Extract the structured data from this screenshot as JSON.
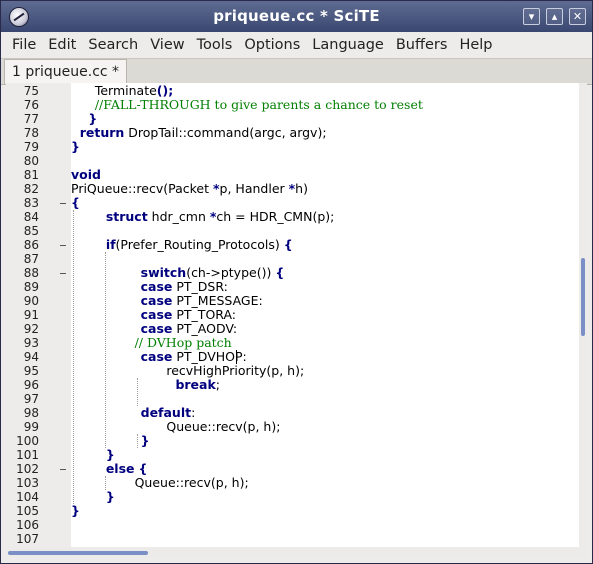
{
  "window": {
    "title": "priqueue.cc * SciTE",
    "controls": {
      "minimize": "▾",
      "maximize": "▴",
      "close": "✕"
    }
  },
  "menu": [
    "File",
    "Edit",
    "Search",
    "View",
    "Tools",
    "Options",
    "Language",
    "Buffers",
    "Help"
  ],
  "tabs": [
    {
      "label": "1 priqueue.cc *",
      "active": true
    }
  ],
  "editor": {
    "lines": [
      {
        "num": "75",
        "indent": 1,
        "fold": false,
        "tokens": [
          {
            "t": "      Terminate",
            "c": ""
          },
          {
            "t": "();",
            "c": "kw"
          }
        ]
      },
      {
        "num": "76",
        "indent": 1,
        "fold": false,
        "tokens": [
          {
            "t": "      //FALL-THROUGH to give parents a chance to reset",
            "c": "cm"
          }
        ]
      },
      {
        "num": "77",
        "indent": 1,
        "fold": false,
        "tokens": [
          {
            "t": "    }",
            "c": "kw"
          }
        ]
      },
      {
        "num": "78",
        "indent": 0,
        "fold": false,
        "tokens": [
          {
            "t": "  return",
            "c": "kw"
          },
          {
            "t": " DropTail::command(argc, argv);",
            "c": ""
          }
        ]
      },
      {
        "num": "79",
        "indent": 0,
        "fold": false,
        "tokens": [
          {
            "t": "}",
            "c": "kw"
          }
        ]
      },
      {
        "num": "80",
        "indent": 0,
        "fold": false,
        "tokens": [
          {
            "t": "",
            "c": ""
          }
        ]
      },
      {
        "num": "81",
        "indent": 0,
        "fold": false,
        "tokens": [
          {
            "t": "void",
            "c": "kw"
          }
        ]
      },
      {
        "num": "82",
        "indent": 0,
        "fold": false,
        "tokens": [
          {
            "t": "PriQueue::recv(Packet ",
            "c": ""
          },
          {
            "t": "*",
            "c": "kw"
          },
          {
            "t": "p, Handler ",
            "c": ""
          },
          {
            "t": "*",
            "c": "kw"
          },
          {
            "t": "h)",
            "c": ""
          }
        ]
      },
      {
        "num": "83",
        "indent": 0,
        "fold": true,
        "tokens": [
          {
            "t": "{",
            "c": "kw"
          }
        ]
      },
      {
        "num": "84",
        "indent": 0,
        "fold": false,
        "tokens": [
          {
            "t": "        struct",
            "c": "kw"
          },
          {
            "t": " hdr_cmn ",
            "c": ""
          },
          {
            "t": "*",
            "c": "kw"
          },
          {
            "t": "ch = HDR_CMN(p);",
            "c": ""
          }
        ]
      },
      {
        "num": "85",
        "indent": 0,
        "fold": false,
        "tokens": [
          {
            "t": "",
            "c": ""
          }
        ]
      },
      {
        "num": "86",
        "indent": 0,
        "fold": true,
        "tokens": [
          {
            "t": "        if",
            "c": "kw"
          },
          {
            "t": "(Prefer_Routing_Protocols) ",
            "c": ""
          },
          {
            "t": "{",
            "c": "kw"
          }
        ]
      },
      {
        "num": "87",
        "indent": 0,
        "fold": false,
        "tokens": [
          {
            "t": "",
            "c": ""
          }
        ]
      },
      {
        "num": "88",
        "indent": 0,
        "fold": true,
        "tokens": [
          {
            "t": "                switch",
            "c": "kw"
          },
          {
            "t": "(ch->ptype()) ",
            "c": ""
          },
          {
            "t": "{",
            "c": "kw"
          }
        ]
      },
      {
        "num": "89",
        "indent": 0,
        "fold": false,
        "tokens": [
          {
            "t": "                case",
            "c": "kw"
          },
          {
            "t": " PT_DSR:",
            "c": ""
          }
        ]
      },
      {
        "num": "90",
        "indent": 0,
        "fold": false,
        "tokens": [
          {
            "t": "                case",
            "c": "kw"
          },
          {
            "t": " PT_MESSAGE:",
            "c": ""
          }
        ]
      },
      {
        "num": "91",
        "indent": 0,
        "fold": false,
        "tokens": [
          {
            "t": "                case",
            "c": "kw"
          },
          {
            "t": " PT_TORA:",
            "c": ""
          }
        ]
      },
      {
        "num": "92",
        "indent": 0,
        "fold": false,
        "tokens": [
          {
            "t": "                case",
            "c": "kw"
          },
          {
            "t": " PT_AODV:",
            "c": ""
          }
        ]
      },
      {
        "num": "93",
        "indent": 0,
        "fold": false,
        "tokens": [
          {
            "t": "                // DVHop patch",
            "c": "cm"
          }
        ]
      },
      {
        "num": "94",
        "indent": 0,
        "fold": false,
        "tokens": [
          {
            "t": "                case",
            "c": "kw"
          },
          {
            "t": " PT_DVHOP:",
            "c": ""
          }
        ]
      },
      {
        "num": "95",
        "indent": 0,
        "fold": false,
        "tokens": [
          {
            "t": "                        recvHighPriority(p, h);",
            "c": ""
          }
        ]
      },
      {
        "num": "96",
        "indent": 0,
        "fold": false,
        "tokens": [
          {
            "t": "                        break",
            "c": "kw"
          },
          {
            "t": ";",
            "c": ""
          }
        ]
      },
      {
        "num": "97",
        "indent": 0,
        "fold": false,
        "tokens": [
          {
            "t": "",
            "c": ""
          }
        ]
      },
      {
        "num": "98",
        "indent": 0,
        "fold": false,
        "tokens": [
          {
            "t": "                default",
            "c": "kw"
          },
          {
            "t": ":",
            "c": ""
          }
        ]
      },
      {
        "num": "99",
        "indent": 0,
        "fold": false,
        "tokens": [
          {
            "t": "                        Queue::recv(p, h);",
            "c": ""
          }
        ]
      },
      {
        "num": "100",
        "indent": 0,
        "fold": false,
        "tokens": [
          {
            "t": "                }",
            "c": "kw"
          }
        ]
      },
      {
        "num": "101",
        "indent": 0,
        "fold": false,
        "tokens": [
          {
            "t": "        }",
            "c": "kw"
          }
        ]
      },
      {
        "num": "102",
        "indent": 0,
        "fold": true,
        "tokens": [
          {
            "t": "        else",
            "c": "kw"
          },
          {
            "t": " ",
            "c": ""
          },
          {
            "t": "{",
            "c": "kw"
          }
        ]
      },
      {
        "num": "103",
        "indent": 0,
        "fold": false,
        "tokens": [
          {
            "t": "                Queue::recv(p, h);",
            "c": ""
          }
        ]
      },
      {
        "num": "104",
        "indent": 0,
        "fold": false,
        "tokens": [
          {
            "t": "        }",
            "c": "kw"
          }
        ]
      },
      {
        "num": "105",
        "indent": 0,
        "fold": false,
        "tokens": [
          {
            "t": "}",
            "c": "kw"
          }
        ]
      },
      {
        "num": "106",
        "indent": 0,
        "fold": false,
        "tokens": [
          {
            "t": "",
            "c": ""
          }
        ]
      },
      {
        "num": "107",
        "indent": 0,
        "fold": false,
        "tokens": [
          {
            "t": "",
            "c": ""
          }
        ]
      }
    ]
  },
  "colors": {
    "keyword": "#00007f",
    "comment": "#007f00",
    "titlebar": "#4a5680",
    "scroll_thumb": "#7b8fc7"
  },
  "icons": {
    "app": "scite-app-icon"
  }
}
